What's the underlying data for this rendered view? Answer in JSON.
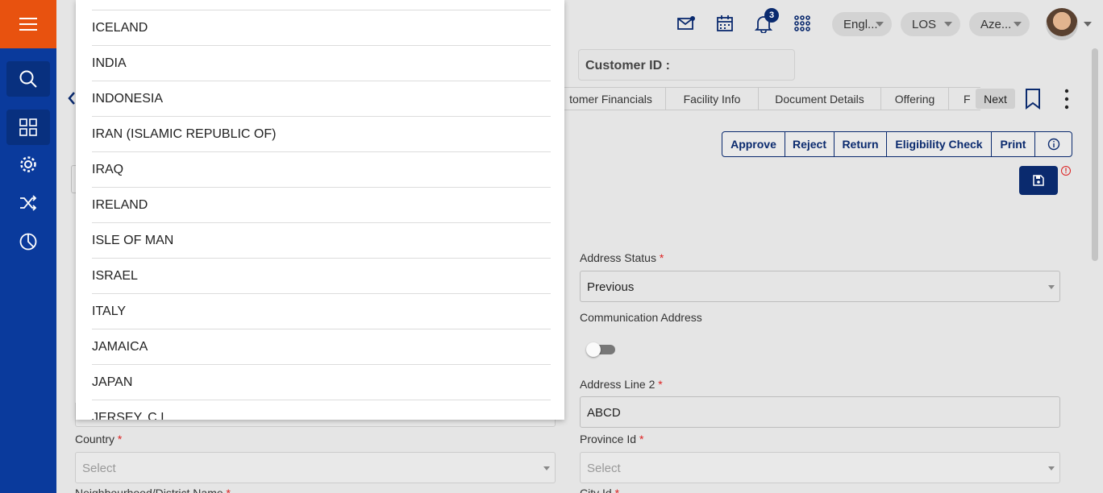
{
  "topbar": {
    "notification_count": "3",
    "language": "Engl...",
    "module": "LOS",
    "user": "Aze..."
  },
  "customer_id_label": "Customer ID :",
  "tabs": [
    {
      "label": "tomer Financials"
    },
    {
      "label": "Facility Info"
    },
    {
      "label": "Document Details"
    },
    {
      "label": "Offering"
    },
    {
      "label": "F"
    }
  ],
  "next_label": "Next",
  "actions": {
    "approve": "Approve",
    "reject": "Reject",
    "return": "Return",
    "eligibility": "Eligibility Check",
    "print": "Print"
  },
  "form": {
    "address_status": {
      "label": "Address Status",
      "value": "Previous"
    },
    "communication_address": {
      "label": "Communication Address"
    },
    "address_line2": {
      "label": "Address Line 2",
      "value": "ABCD"
    },
    "country": {
      "label": "Country",
      "placeholder": "Select"
    },
    "province_id": {
      "label": "Province Id",
      "placeholder": "Select"
    },
    "neighbourhood": {
      "label": "Neighbourhood/District Name"
    },
    "city_id": {
      "label": "City Id"
    },
    "required_mark": "*"
  },
  "country_dropdown": {
    "items": [
      "",
      "ICELAND",
      "INDIA",
      "INDONESIA",
      "IRAN (ISLAMIC REPUBLIC OF)",
      "IRAQ",
      "IRELAND",
      "ISLE OF MAN",
      "ISRAEL",
      "ITALY",
      "JAMAICA",
      "JAPAN",
      "JERSEY, C.I."
    ]
  },
  "colors": {
    "sidebar": "#0a3a9c",
    "menu_button": "#e8520f",
    "primary": "#0a2a6e",
    "required": "#d22222"
  }
}
